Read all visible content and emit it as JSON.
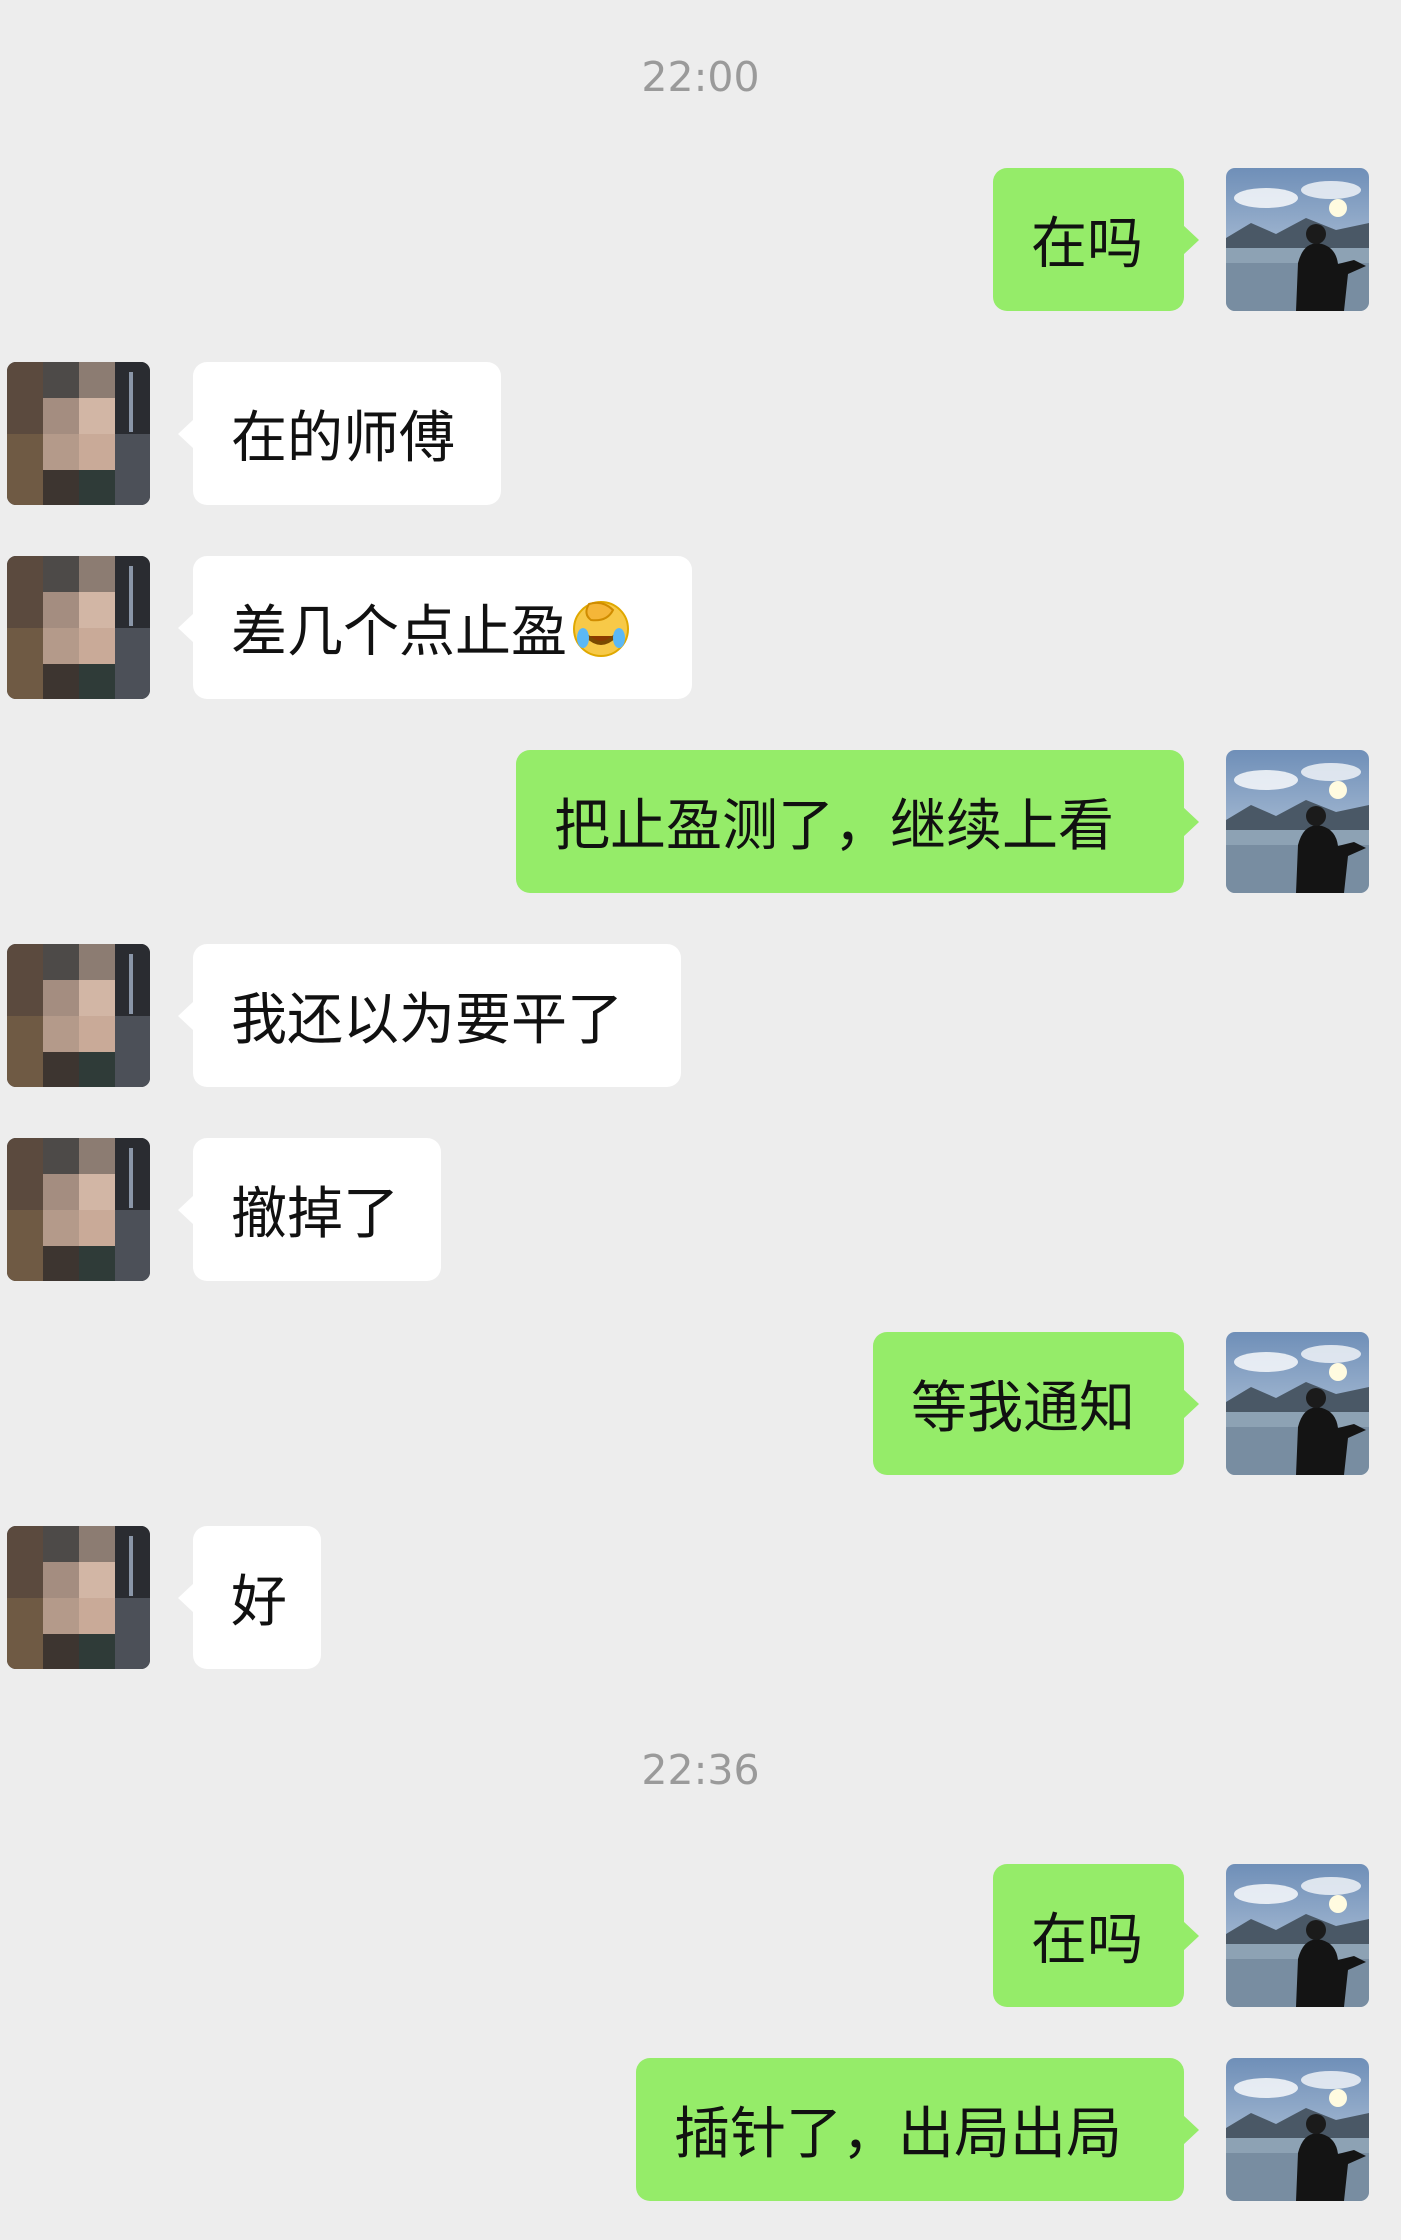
{
  "timestamps": [
    "22:00",
    "22:36"
  ],
  "messages": [
    {
      "side": "out",
      "text": "在吗"
    },
    {
      "side": "in",
      "text": "在的师傅"
    },
    {
      "side": "in",
      "text": "差几个点止盈",
      "emoji": "crying-facepalm-emoji"
    },
    {
      "side": "out",
      "text": "把止盈测了，继续上看"
    },
    {
      "side": "in",
      "text": "我还以为要平了"
    },
    {
      "side": "in",
      "text": "撤掉了"
    },
    {
      "side": "out",
      "text": "等我通知"
    },
    {
      "side": "in",
      "text": "好"
    },
    {
      "side": "out",
      "text": "在吗"
    },
    {
      "side": "out",
      "text": "插针了，出局出局"
    }
  ],
  "colors": {
    "background": "#ededed",
    "incoming_bubble": "#ffffff",
    "outgoing_bubble": "#95ec69",
    "timestamp_text": "#9a9a9a"
  },
  "avatars": {
    "contact": "blurred-contact-avatar",
    "self": "lake-landscape-avatar"
  }
}
